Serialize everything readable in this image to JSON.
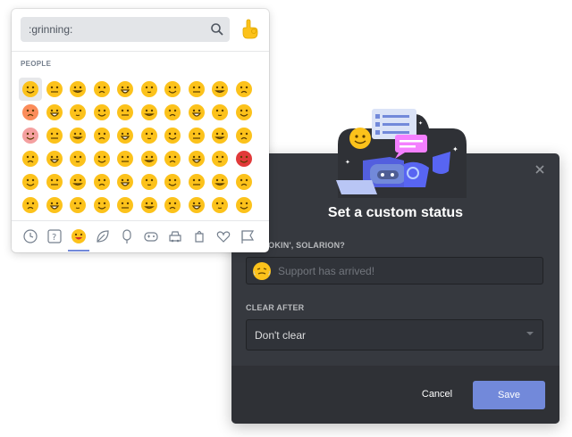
{
  "picker": {
    "search_value": ":grinning:",
    "category_title": "PEOPLE",
    "categories": [
      "recent-icon",
      "custom-icon",
      "people-icon",
      "nature-icon",
      "food-icon",
      "activity-icon",
      "travel-icon",
      "objects-icon",
      "symbols-icon",
      "flags-icon"
    ],
    "active_category": "people-icon",
    "grid_rows": 6,
    "grid_cols": 10
  },
  "modal": {
    "title": "Set a custom status",
    "status_label": "'S COOKIN', SOLARION?",
    "status_placeholder": "Support has arrived!",
    "clear_after_label": "CLEAR AFTER",
    "clear_after_value": "Don't clear",
    "cancel_label": "Cancel",
    "save_label": "Save"
  },
  "colors": {
    "accent": "#7289da",
    "modal_bg": "#36393f",
    "footer_bg": "#2f3136",
    "emoji_yellow": "#fcc21b"
  }
}
